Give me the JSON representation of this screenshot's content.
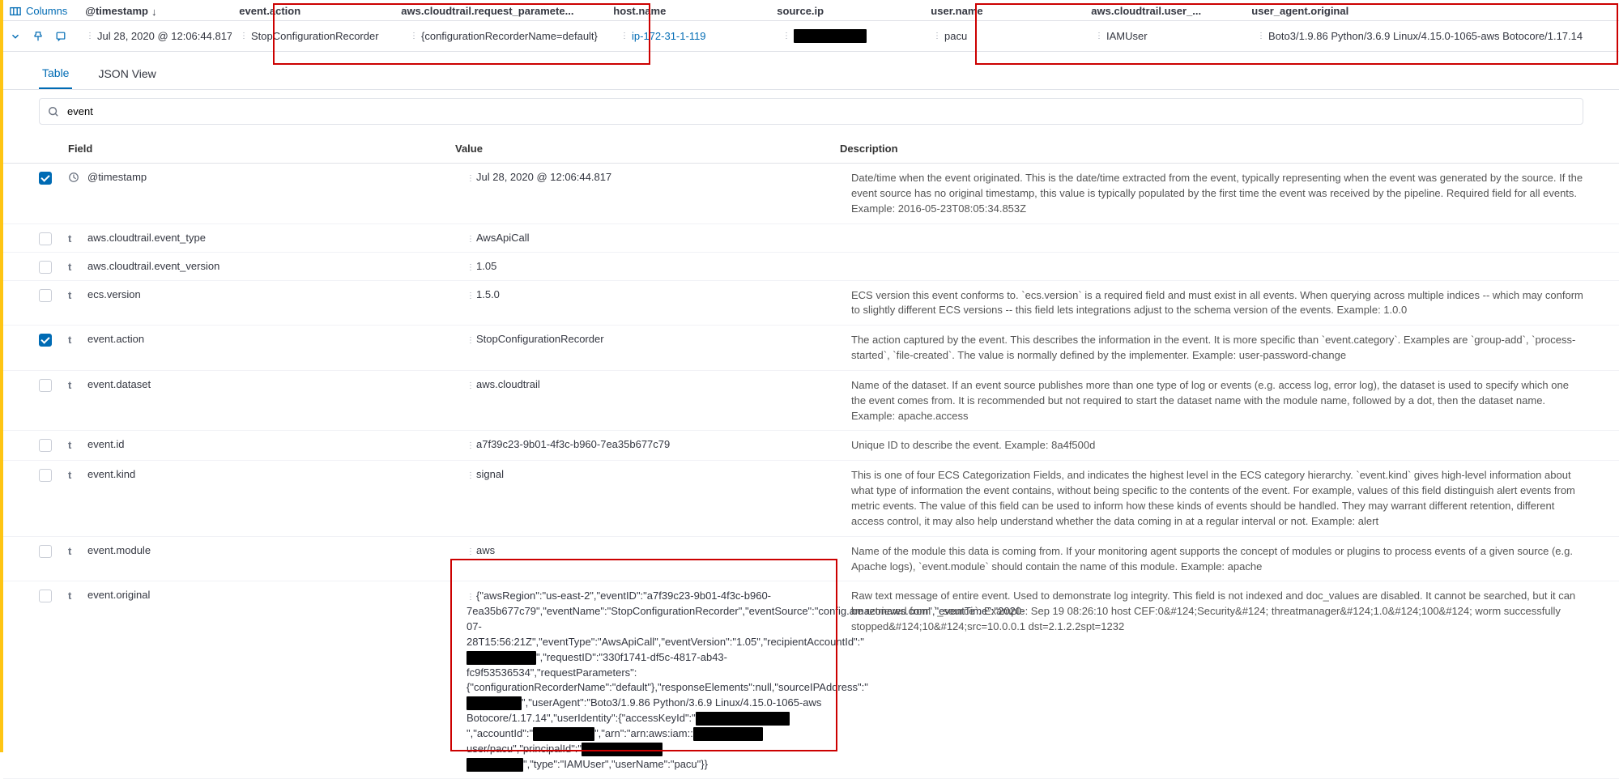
{
  "header": {
    "columns_label": "Columns",
    "cols": {
      "timestamp": "@timestamp",
      "action": "event.action",
      "request": "aws.cloudtrail.request_paramete...",
      "host": "host.name",
      "source": "source.ip",
      "user": "user.name",
      "ctuser": "aws.cloudtrail.user_...",
      "ua": "user_agent.original"
    }
  },
  "row": {
    "timestamp": "Jul 28, 2020 @ 12:06:44.817",
    "action": "StopConfigurationRecorder",
    "request": "{configurationRecorderName=default}",
    "host": "ip-172-31-1-119",
    "user": "pacu",
    "ctuser": "IAMUser",
    "ua": "Boto3/1.9.86 Python/3.6.9 Linux/4.15.0-1065-aws Botocore/1.17.14"
  },
  "tabs": {
    "table": "Table",
    "json": "JSON View"
  },
  "search": {
    "value": "event"
  },
  "details_header": {
    "field": "Field",
    "value": "Value",
    "description": "Description"
  },
  "fields": [
    {
      "checked": true,
      "type": "clock",
      "name": "@timestamp",
      "value": "Jul 28, 2020 @ 12:06:44.817",
      "desc": "Date/time when the event originated. This is the date/time extracted from the event, typically representing when the event was generated by the source. If the event source has no original timestamp, this value is typically populated by the first time the event was received by the pipeline. Required field for all events. Example: 2016-05-23T08:05:34.853Z"
    },
    {
      "checked": false,
      "type": "t",
      "name": "aws.cloudtrail.event_type",
      "value": "AwsApiCall",
      "desc": ""
    },
    {
      "checked": false,
      "type": "t",
      "name": "aws.cloudtrail.event_version",
      "value": "1.05",
      "desc": ""
    },
    {
      "checked": false,
      "type": "t",
      "name": "ecs.version",
      "value": "1.5.0",
      "desc": "ECS version this event conforms to. `ecs.version` is a required field and must exist in all events. When querying across multiple indices -- which may conform to slightly different ECS versions -- this field lets integrations adjust to the schema version of the events. Example: 1.0.0"
    },
    {
      "checked": true,
      "type": "t",
      "name": "event.action",
      "value": "StopConfigurationRecorder",
      "desc": "The action captured by the event. This describes the information in the event. It is more specific than `event.category`. Examples are `group-add`, `process-started`, `file-created`. The value is normally defined by the implementer. Example: user-password-change"
    },
    {
      "checked": false,
      "type": "t",
      "name": "event.dataset",
      "value": "aws.cloudtrail",
      "desc": "Name of the dataset. If an event source publishes more than one type of log or events (e.g. access log, error log), the dataset is used to specify which one the event comes from. It is recommended but not required to start the dataset name with the module name, followed by a dot, then the dataset name. Example: apache.access"
    },
    {
      "checked": false,
      "type": "t",
      "name": "event.id",
      "value": "a7f39c23-9b01-4f3c-b960-7ea35b677c79",
      "desc": "Unique ID to describe the event. Example: 8a4f500d"
    },
    {
      "checked": false,
      "type": "t",
      "name": "event.kind",
      "value": "signal",
      "desc": "This is one of four ECS Categorization Fields, and indicates the highest level in the ECS category hierarchy. `event.kind` gives high-level information about what type of information the event contains, without being specific to the contents of the event. For example, values of this field distinguish alert events from metric events. The value of this field can be used to inform how these kinds of events should be handled. They may warrant different retention, different access control, it may also help understand whether the data coming in at a regular interval or not. Example: alert"
    },
    {
      "checked": false,
      "type": "t",
      "name": "event.module",
      "value": "aws",
      "desc": "Name of the module this data is coming from. If your monitoring agent supports the concept of modules or plugins to process events of a given source (e.g. Apache logs), `event.module` should contain the name of this module. Example: apache"
    }
  ],
  "event_original": {
    "name": "event.original",
    "desc": "Raw text message of entire event. Used to demonstrate log integrity. This field is not indexed and doc_values are disabled. It cannot be searched, but it can be retrieved from `_source`. Example: Sep 19 08:26:10 host CEF:0&#124;Security&#124; threatmanager&#124;1.0&#124;100&#124; worm successfully stopped&#124;10&#124;src=10.0.0.1 dst=2.1.2.2spt=1232",
    "parts": {
      "p1": "{\"awsRegion\":\"us-east-2\",\"eventID\":\"a7f39c23-9b01-4f3c-b960-7ea35b677c79\",\"eventName\":\"StopConfigurationRecorder\",\"eventSource\":\"config.amazonaws.com\",\"eventTime\":\"2020-07-28T15:56:21Z\",\"eventType\":\"AwsApiCall\",\"eventVersion\":\"1.05\",\"recipientAccountId\":\"",
      "p2": "\",\"requestID\":\"330f1741-df5c-4817-ab43-fc9f53536534\",\"requestParameters\":{\"configurationRecorderName\":\"default\"},\"responseElements\":null,\"sourceIPAddress\":\"",
      "p3": "\",\"userAgent\":\"Boto3/1.9.86 Python/3.6.9 Linux/4.15.0-1065-aws Botocore/1.17.14\",\"userIdentity\":{\"accessKeyId\":\"",
      "p4": "\",\"accountId\":\"",
      "p5": "\",\"arn\":\"arn:aws:iam::",
      "p6": "user/pacu\",\"principalId\":\"",
      "p7": "\",\"type\":\"IAMUser\",\"userName\":\"pacu\"}}"
    }
  }
}
